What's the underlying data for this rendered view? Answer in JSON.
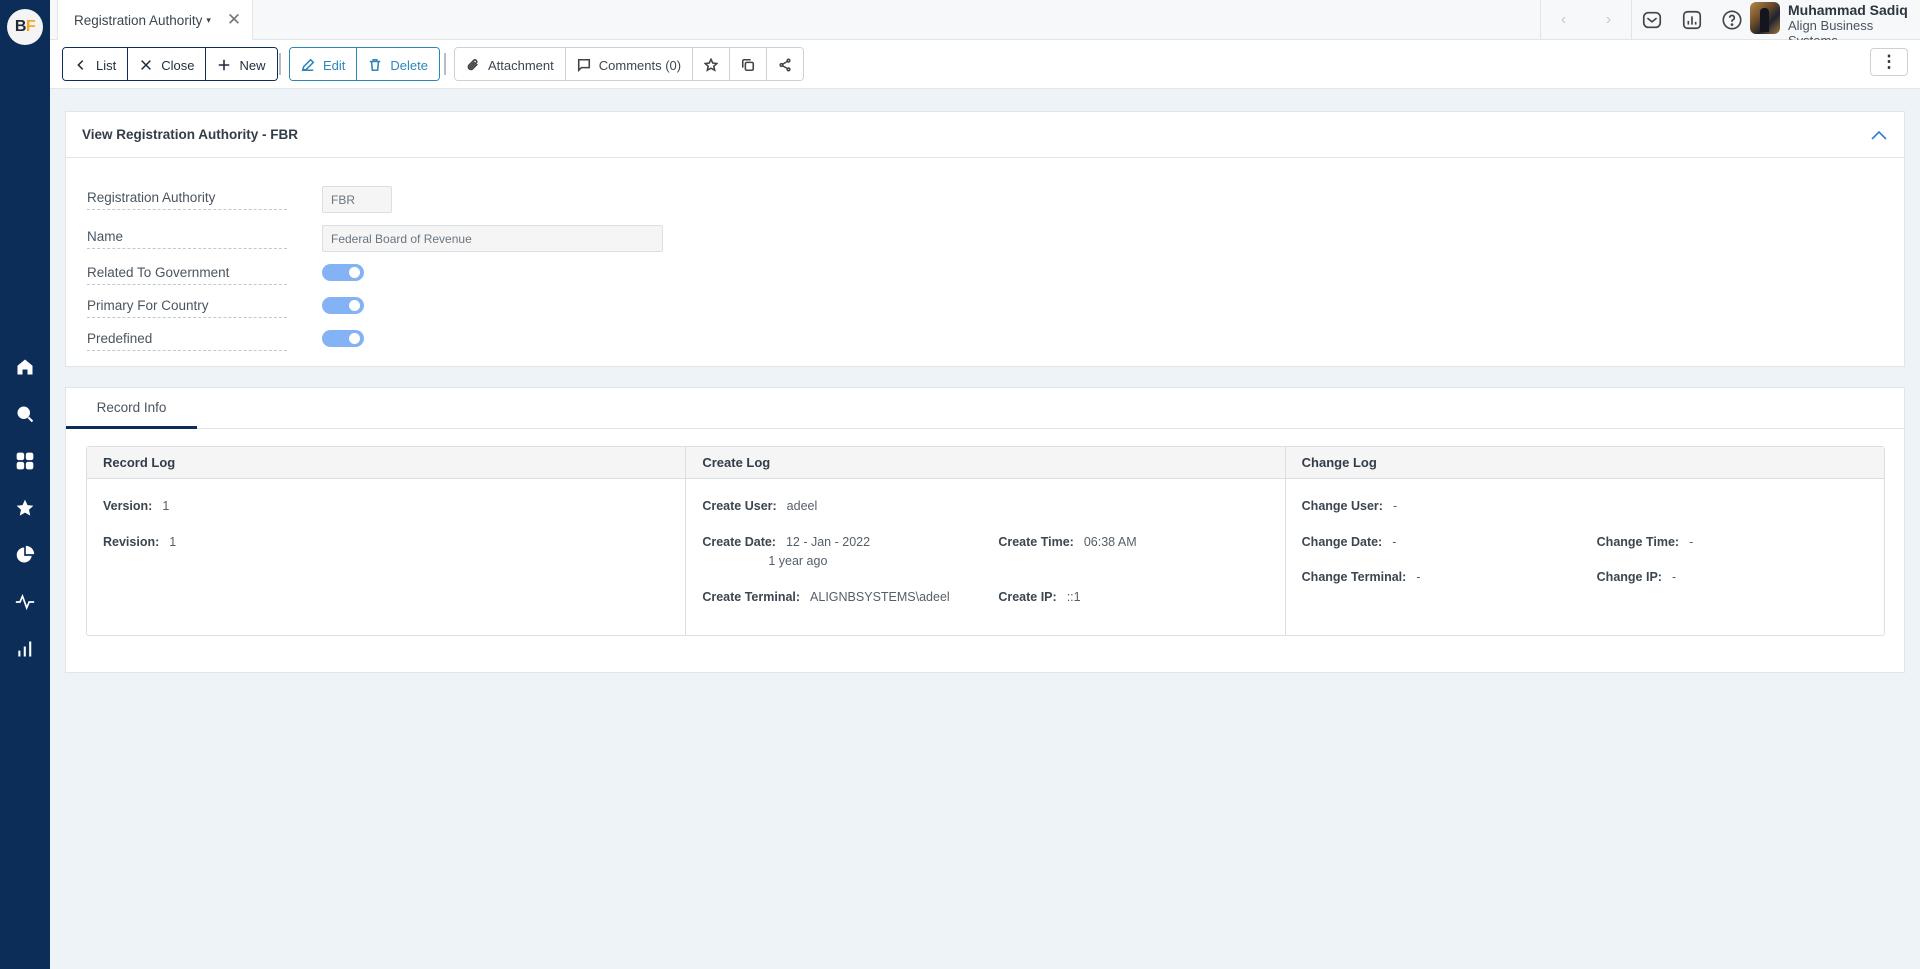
{
  "app": {
    "logo_b": "B",
    "logo_f": "F"
  },
  "sidebar": {
    "items": [
      {
        "name": "home",
        "icon": "home-icon"
      },
      {
        "name": "search",
        "icon": "search-icon"
      },
      {
        "name": "apps",
        "icon": "grid-icon"
      },
      {
        "name": "favorites",
        "icon": "star-icon"
      },
      {
        "name": "analytics",
        "icon": "pie-chart-icon"
      },
      {
        "name": "activity",
        "icon": "activity-icon"
      },
      {
        "name": "reports",
        "icon": "bar-chart-icon"
      }
    ]
  },
  "topbar": {
    "tab_label": "Registration Authority",
    "tab_caret": "▾",
    "tab_close": "✕",
    "prev": "‹",
    "next": "›",
    "user_name": "Muhammad Sadiq",
    "user_org": "Align Business Systems"
  },
  "toolbar": {
    "list": "List",
    "close": "Close",
    "new": "New",
    "edit": "Edit",
    "delete": "Delete",
    "attachment": "Attachment",
    "comments": "Comments (0)",
    "more": "⋮"
  },
  "form": {
    "title": "View Registration Authority - FBR",
    "fields": [
      {
        "label": "Registration Authority",
        "value": "FBR"
      },
      {
        "label": "Name",
        "value": "Federal Board of Revenue"
      }
    ],
    "toggles": [
      {
        "label": "Related To Government",
        "on": true
      },
      {
        "label": "Primary For Country",
        "on": true
      },
      {
        "label": "Predefined",
        "on": true
      }
    ]
  },
  "record": {
    "tab": "Record Info",
    "record_log": {
      "title": "Record Log",
      "version_label": "Version:",
      "version": "1",
      "revision_label": "Revision:",
      "revision": "1"
    },
    "create_log": {
      "title": "Create Log",
      "user_label": "Create User:",
      "user": "adeel",
      "date_label": "Create Date:",
      "date": "12 - Jan - 2022",
      "date_relative": "1 year ago",
      "time_label": "Create Time:",
      "time": "06:38 AM",
      "terminal_label": "Create Terminal:",
      "terminal": "ALIGNBSYSTEMS\\adeel",
      "ip_label": "Create IP:",
      "ip": "::1"
    },
    "change_log": {
      "title": "Change Log",
      "user_label": "Change User:",
      "user": "-",
      "date_label": "Change Date:",
      "date": "-",
      "time_label": "Change Time:",
      "time": "-",
      "terminal_label": "Change Terminal:",
      "terminal": "-",
      "ip_label": "Change IP:",
      "ip": "-"
    }
  }
}
